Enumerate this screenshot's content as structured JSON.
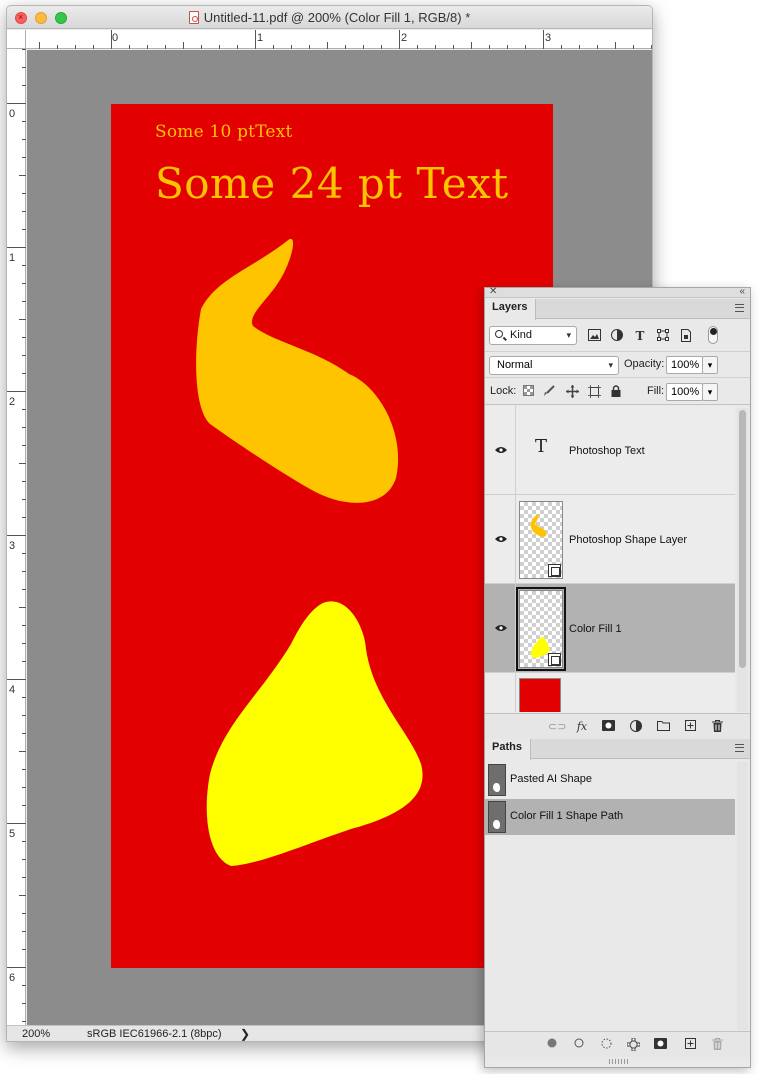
{
  "window": {
    "title": "Untitled-11.pdf @ 200% (Color Fill 1, RGB/8) *"
  },
  "rulers": {
    "top_labels": [
      "0",
      "1",
      "2",
      "3"
    ],
    "left_labels": [
      "0",
      "1",
      "2",
      "3",
      "4",
      "5",
      "6"
    ]
  },
  "canvas": {
    "text_small": "Some 10 ptText",
    "text_large": "Some 24 pt Text",
    "background_color": "#e30000",
    "text_color": "#ffc400",
    "shape1_color": "#ffc400",
    "shape2_color": "#ffff00"
  },
  "statusbar": {
    "zoom": "200%",
    "profile": "sRGB IEC61966-2.1 (8bpc)",
    "arrow": "❯"
  },
  "layers_panel": {
    "tab_label": "Layers",
    "filter_kind": "Kind",
    "blend_mode": "Normal",
    "opacity_label": "Opacity:",
    "opacity_value": "100%",
    "lock_label": "Lock:",
    "fill_label": "Fill:",
    "fill_value": "100%",
    "layers": [
      {
        "name": "Photoshop Text",
        "visible": true,
        "selected": false
      },
      {
        "name": "Photoshop Shape Layer",
        "visible": true,
        "selected": false
      },
      {
        "name": "Color Fill 1",
        "visible": true,
        "selected": true
      },
      {
        "name": "",
        "visible": false,
        "selected": false
      }
    ]
  },
  "paths_panel": {
    "tab_label": "Paths",
    "paths": [
      {
        "name": "Pasted AI Shape",
        "selected": false
      },
      {
        "name": "Color Fill 1 Shape Path",
        "selected": true
      }
    ]
  }
}
